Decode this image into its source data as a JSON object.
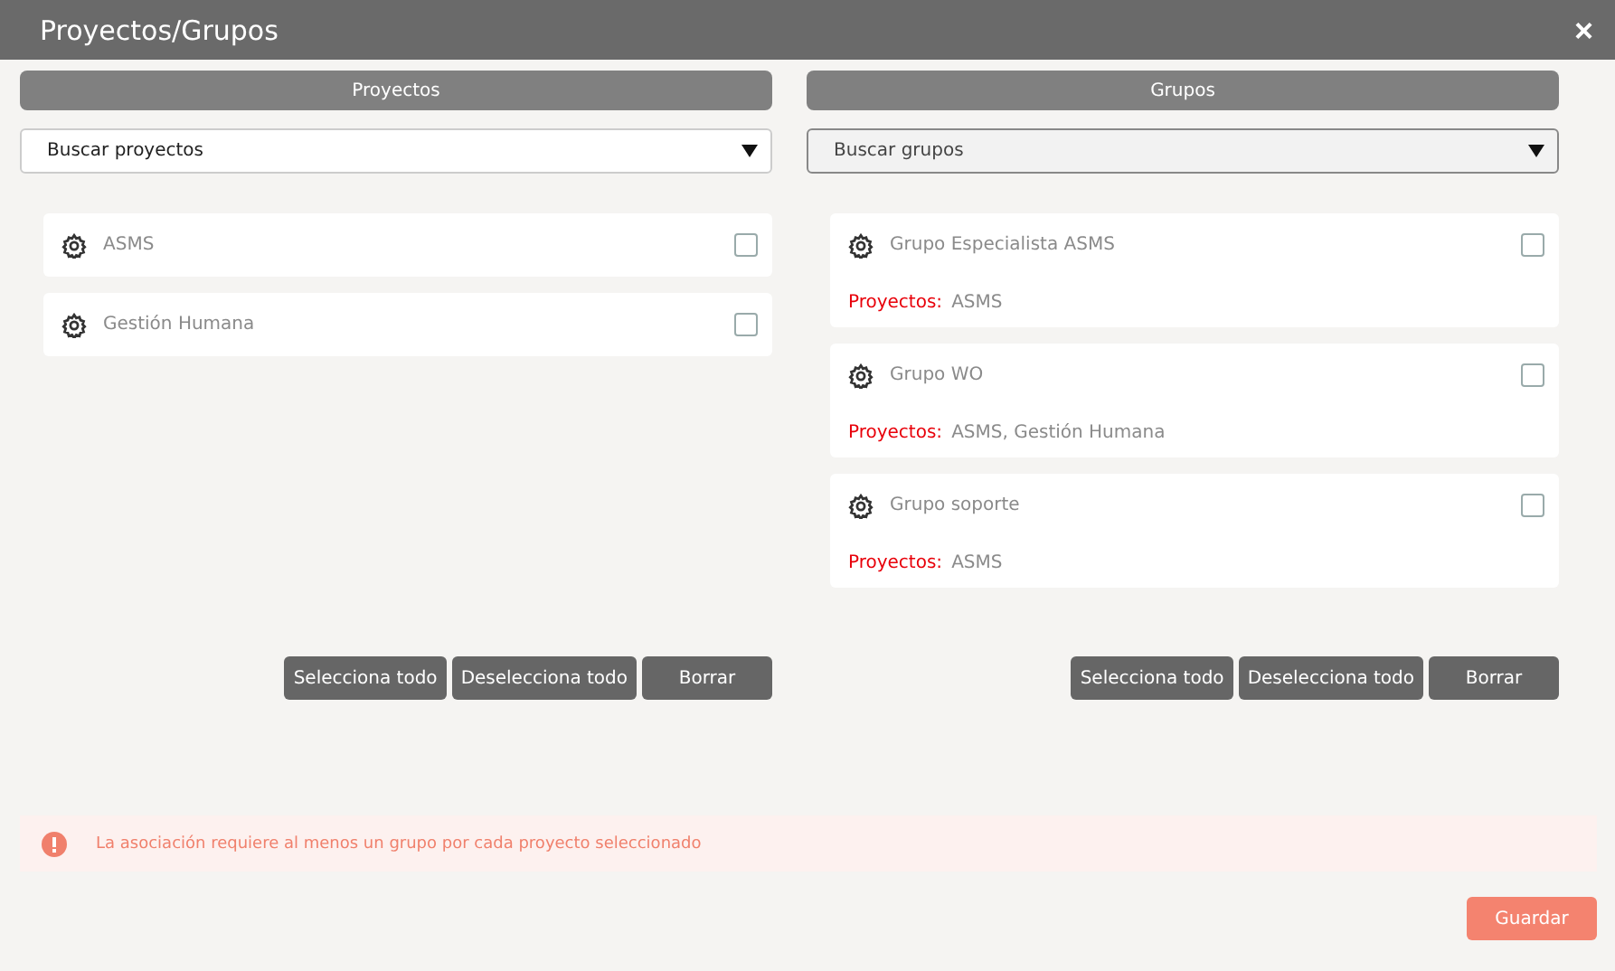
{
  "window": {
    "title": "Proyectos/Grupos",
    "close": "×"
  },
  "columns": [
    {
      "header": "Proyectos",
      "search": {
        "placeholder": "Buscar proyectos",
        "focused": false
      },
      "items": [
        {
          "name": "ASMS",
          "checked": false
        },
        {
          "name": "Gestión Humana",
          "checked": false
        }
      ],
      "buttons": [
        "Selecciona todo",
        "Deselecciona todo",
        "Borrar"
      ]
    },
    {
      "header": "Grupos",
      "search": {
        "placeholder": "Buscar grupos",
        "focused": true
      },
      "items": [
        {
          "name": "Grupo Especialista ASMS",
          "checked": false,
          "projects_label": "Proyectos:",
          "projects": "ASMS"
        },
        {
          "name": "Grupo WO",
          "checked": false,
          "projects_label": "Proyectos:",
          "projects": "ASMS, Gestión Humana"
        },
        {
          "name": "Grupo soporte",
          "checked": false,
          "projects_label": "Proyectos:",
          "projects": "ASMS"
        }
      ],
      "buttons": [
        "Selecciona todo",
        "Deselecciona todo",
        "Borrar"
      ]
    }
  ],
  "alert": {
    "message": "La asociación requiere al menos un grupo por cada proyecto seleccionado"
  },
  "save_button": "Guardar"
}
